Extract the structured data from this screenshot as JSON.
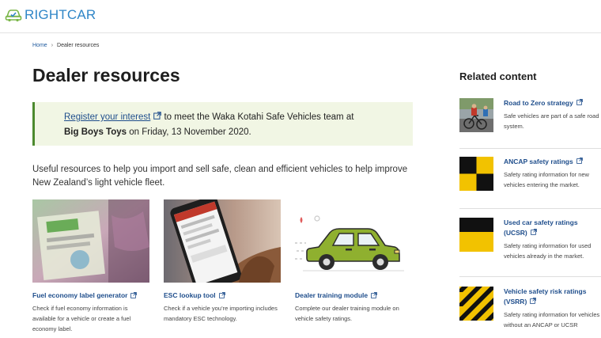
{
  "header": {
    "logo_text": "RIGHTCAR"
  },
  "breadcrumb": {
    "home": "Home",
    "separator": "›",
    "current": "Dealer resources"
  },
  "page_title": "Dealer resources",
  "callout": {
    "link_text": "Register your interest",
    "text_1": " to meet the Waka Kotahi Safe Vehicles team at",
    "venue": "Big Boys Toys",
    "text_2": " on Friday, 13 November 2020."
  },
  "intro": "Useful resources to help you import and sell safe, clean and efficient vehicles to help improve New Zealand’s light vehicle fleet.",
  "cards": [
    {
      "title": "Fuel economy label generator",
      "desc": "Check if fuel economy information is available for a vehicle or create a fuel economy label."
    },
    {
      "title": "ESC lookup tool",
      "desc": "Check if a vehicle you’re importing includes mandatory ESC technology."
    },
    {
      "title": "Dealer training module",
      "desc": "Complete our dealer training module on vehicle safety ratings."
    }
  ],
  "related": {
    "title": "Related content",
    "items": [
      {
        "title": "Road to Zero strategy",
        "desc": "Safe vehicles are part of a safe road system."
      },
      {
        "title": "ANCAP safety ratings",
        "desc": "Safety rating information for new vehicles entering the market."
      },
      {
        "title": "Used car safety ratings (UCSR)",
        "desc": "Safety rating information for used vehicles already in the market."
      },
      {
        "title": "Vehicle safety risk ratings (VSRR)",
        "desc": "Safety rating information for vehicles without an ANCAP or UCSR"
      }
    ]
  },
  "colors": {
    "brand": "#2f86c7",
    "link": "#1f4e8c",
    "callout_bg": "#f1f6e4",
    "callout_border": "#4c8a2e",
    "car_green": "#8fb02f"
  }
}
